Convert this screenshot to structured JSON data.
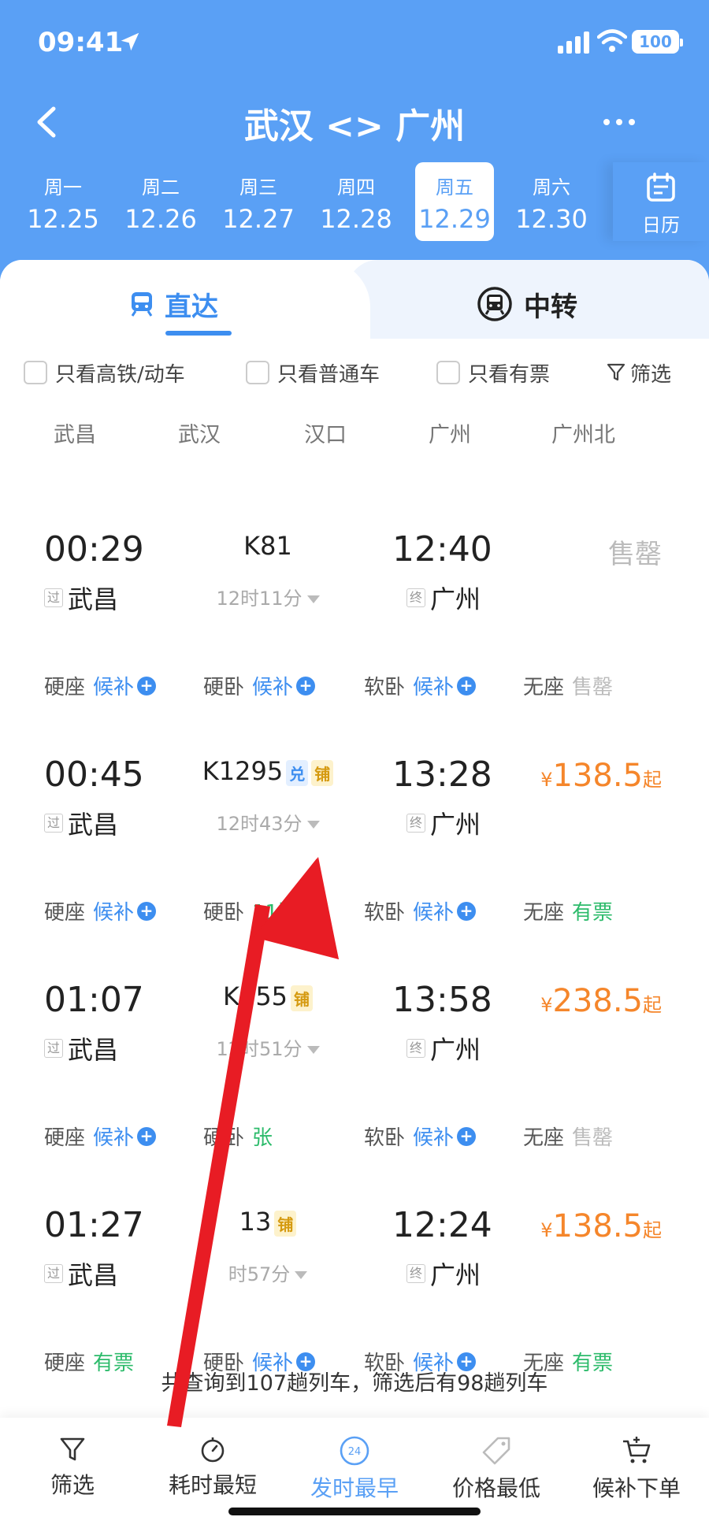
{
  "status_bar": {
    "time": "09:41",
    "battery": "100"
  },
  "nav": {
    "title": "武汉 <> 广州"
  },
  "dates": [
    {
      "weekday": "周一",
      "date": "12.25",
      "selected": false
    },
    {
      "weekday": "周二",
      "date": "12.26",
      "selected": false
    },
    {
      "weekday": "周三",
      "date": "12.27",
      "selected": false
    },
    {
      "weekday": "周四",
      "date": "12.28",
      "selected": false
    },
    {
      "weekday": "周五",
      "date": "12.29",
      "selected": true
    },
    {
      "weekday": "周六",
      "date": "12.30",
      "selected": false
    }
  ],
  "calendar_label": "日历",
  "tabs": {
    "direct": "直达",
    "transfer": "中转"
  },
  "filters": {
    "high_speed_only": "只看高铁/动车",
    "normal_only": "只看普通车",
    "available_only": "只看有票",
    "filter": "筛选"
  },
  "stations": [
    "武昌",
    "武汉",
    "汉口",
    "广州",
    "广州北"
  ],
  "trains": [
    {
      "number": "K81",
      "tags": [],
      "departure": "00:29",
      "arrival": "12:40",
      "duration": "12时11分",
      "from": "武昌",
      "to": "广州",
      "from_badge": "过",
      "to_badge": "终",
      "price_yen": "",
      "price": "",
      "price_suffix": "",
      "price_status": "售罄",
      "seats": [
        {
          "name": "硬座",
          "status": "候补",
          "kind": "wait"
        },
        {
          "name": "硬卧",
          "status": "候补",
          "kind": "wait"
        },
        {
          "name": "软卧",
          "status": "候补",
          "kind": "wait"
        },
        {
          "name": "无座",
          "status": "售罄",
          "kind": "out"
        }
      ]
    },
    {
      "number": "K1295",
      "tags": [
        "兑",
        "铺"
      ],
      "departure": "00:45",
      "arrival": "13:28",
      "duration": "12时43分",
      "from": "武昌",
      "to": "广州",
      "from_badge": "过",
      "to_badge": "终",
      "price_yen": "¥",
      "price": "138.5",
      "price_suffix": "起",
      "price_status": "",
      "seats": [
        {
          "name": "硬座",
          "status": "候补",
          "kind": "wait"
        },
        {
          "name": "硬卧",
          "status": "11张",
          "kind": "avail"
        },
        {
          "name": "软卧",
          "status": "候补",
          "kind": "wait"
        },
        {
          "name": "无座",
          "status": "有票",
          "kind": "avail"
        }
      ]
    },
    {
      "number": "K755",
      "tags": [
        "铺"
      ],
      "departure": "01:07",
      "arrival": "13:58",
      "duration": "12时51分",
      "from": "武昌",
      "to": "广州",
      "from_badge": "过",
      "to_badge": "终",
      "price_yen": "¥",
      "price": "238.5",
      "price_suffix": "起",
      "price_status": "",
      "seats": [
        {
          "name": "硬座",
          "status": "候补",
          "kind": "wait"
        },
        {
          "name": "硬卧",
          "status": "张",
          "kind": "avail"
        },
        {
          "name": "软卧",
          "status": "候补",
          "kind": "wait"
        },
        {
          "name": "无座",
          "status": "售罄",
          "kind": "out"
        }
      ]
    },
    {
      "number": "13",
      "tags": [
        "铺"
      ],
      "departure": "01:27",
      "arrival": "12:24",
      "duration": "时57分",
      "from": "武昌",
      "to": "广州",
      "from_badge": "过",
      "to_badge": "终",
      "price_yen": "¥",
      "price": "138.5",
      "price_suffix": "起",
      "price_status": "",
      "seats": [
        {
          "name": "硬座",
          "status": "有票",
          "kind": "avail"
        },
        {
          "name": "硬卧",
          "status": "候补",
          "kind": "wait"
        },
        {
          "name": "软卧",
          "status": "候补",
          "kind": "wait"
        },
        {
          "name": "无座",
          "status": "有票",
          "kind": "avail"
        }
      ]
    }
  ],
  "summary": "共查询到107趟列车，筛选后有98趟列车",
  "toolbar": [
    {
      "label": "筛选",
      "icon": "funnel-icon",
      "active": false
    },
    {
      "label": "耗时最短",
      "icon": "stopwatch-icon",
      "active": false
    },
    {
      "label": "发时最早",
      "icon": "clock-24-icon",
      "active": true,
      "icon_text": "24"
    },
    {
      "label": "价格最低",
      "icon": "price-tag-icon",
      "active": false
    },
    {
      "label": "候补下单",
      "icon": "cart-plus-icon",
      "active": false
    }
  ],
  "colors": {
    "header": "#5aa0f5",
    "accent": "#3d8ef0",
    "price": "#f5862b",
    "available": "#2dbb6b",
    "annotation_arrow": "#e81c24"
  }
}
